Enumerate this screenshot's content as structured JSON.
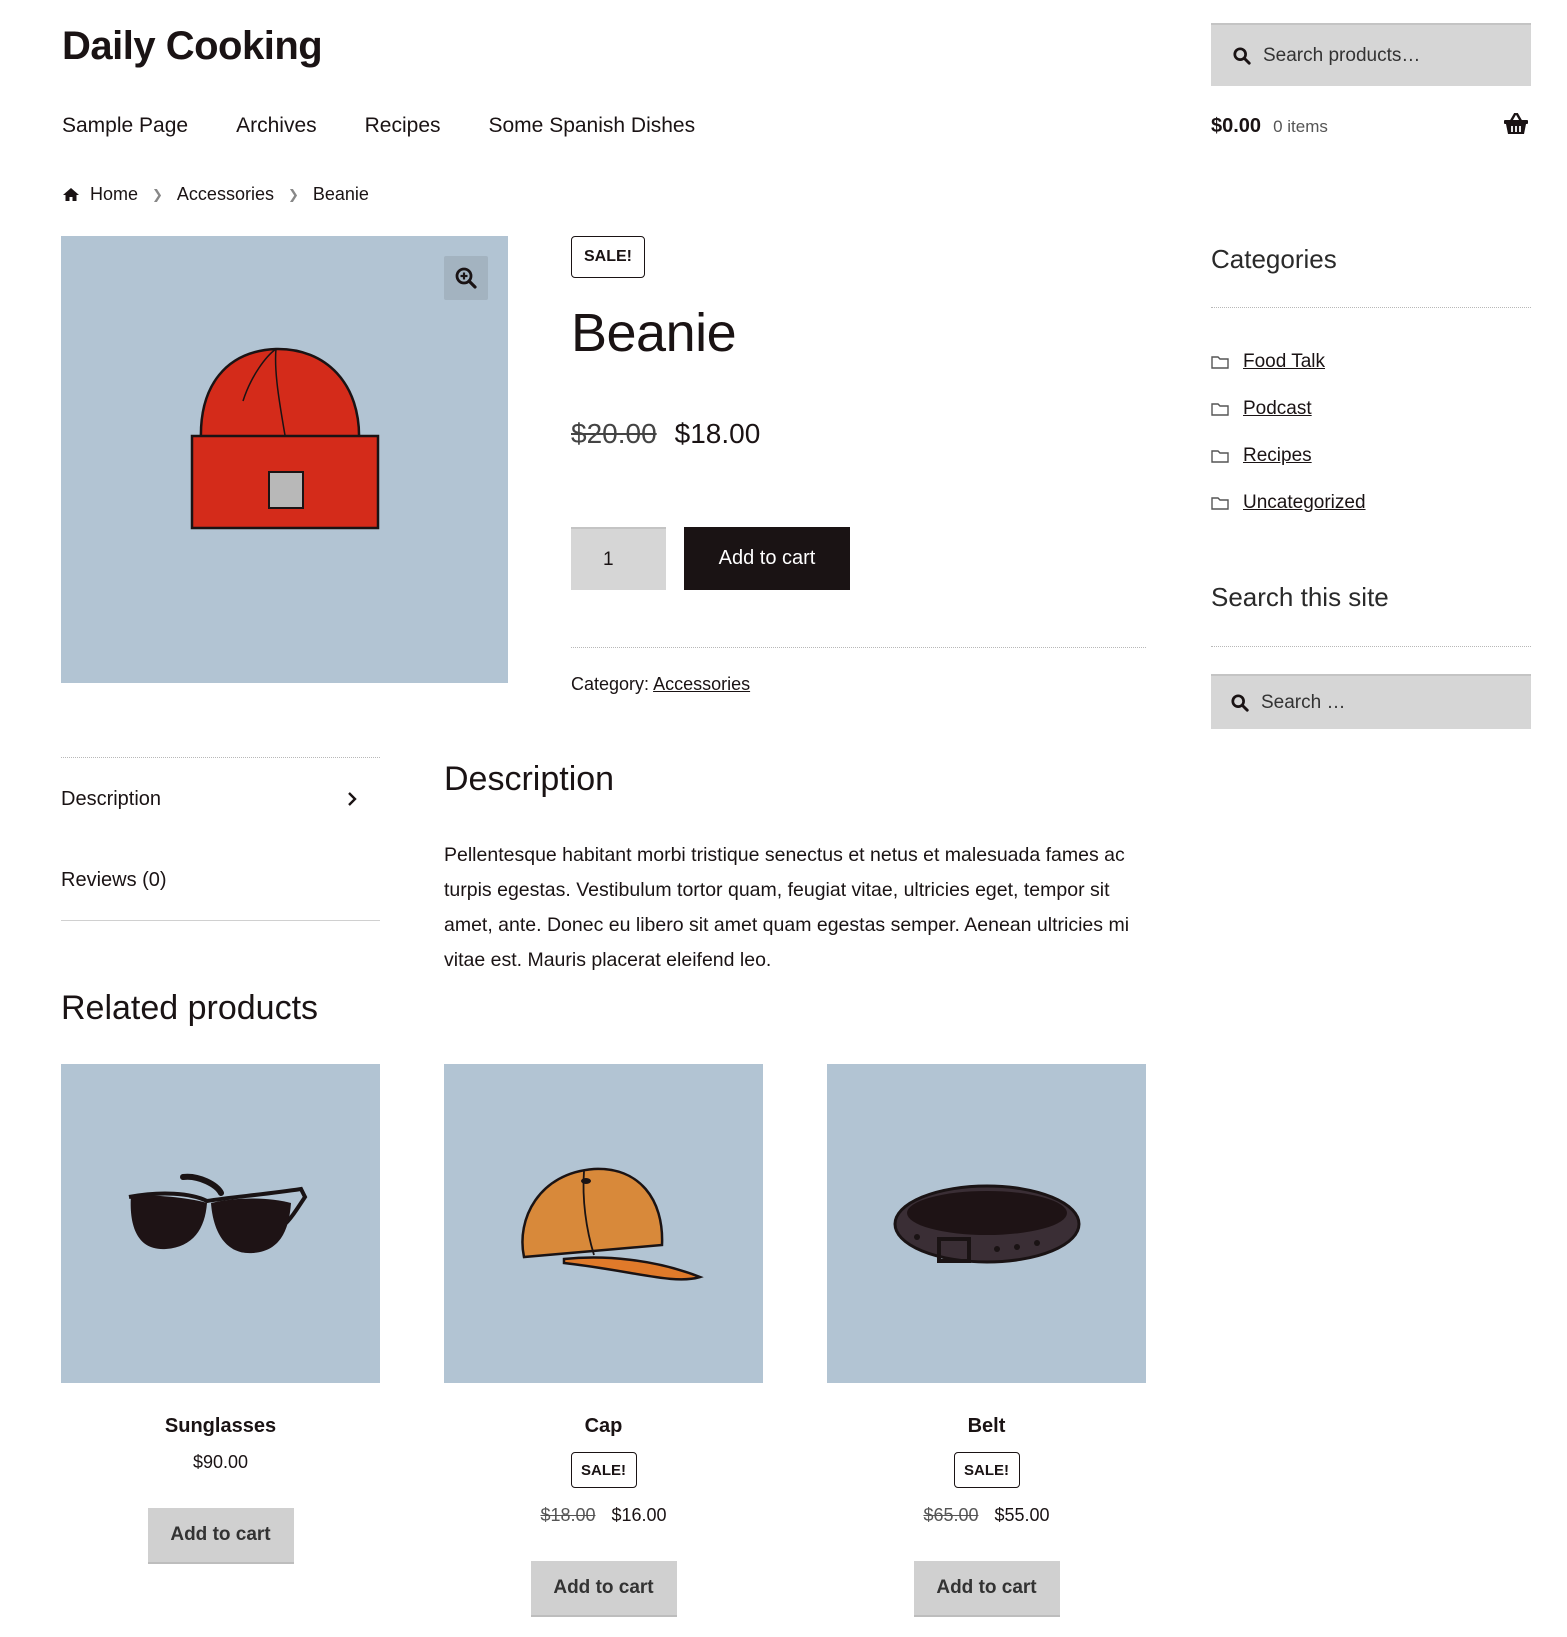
{
  "site": {
    "title": "Daily Cooking"
  },
  "nav": [
    "Sample Page",
    "Archives",
    "Recipes",
    "Some Spanish Dishes"
  ],
  "header_search": {
    "placeholder": "Search products…"
  },
  "cart": {
    "amount": "$0.00",
    "items": "0 items",
    "icon": "basket-icon"
  },
  "breadcrumb": [
    "Home",
    "Accessories",
    "Beanie"
  ],
  "product": {
    "sale_badge": "SALE!",
    "title": "Beanie",
    "old_price": "$20.00",
    "price": "$18.00",
    "quantity": "1",
    "add_to_cart": "Add to cart",
    "category_label": "Category:",
    "category": "Accessories",
    "image_bg": "#b2c4d3"
  },
  "sidebar": {
    "categories_title": "Categories",
    "categories": [
      "Food Talk",
      "Podcast",
      "Recipes",
      "Uncategorized"
    ],
    "search_title": "Search this site",
    "search_placeholder": "Search …"
  },
  "tabs": [
    "Description",
    "Reviews (0)"
  ],
  "description": {
    "title": "Description",
    "text": "Pellentesque habitant morbi tristique senectus et netus et malesuada fames ac turpis egestas. Vestibulum tortor quam, feugiat vitae, ultricies eget, tempor sit amet, ante. Donec eu libero sit amet quam egestas semper. Aenean ultricies mi vitae est. Mauris placerat eleifend leo."
  },
  "related": {
    "title": "Related products",
    "items": [
      {
        "name": "Sunglasses",
        "price": "$90.00",
        "old_price": "",
        "sale": "",
        "button": "Add to cart"
      },
      {
        "name": "Cap",
        "price": "$16.00",
        "old_price": "$18.00",
        "sale": "SALE!",
        "button": "Add to cart"
      },
      {
        "name": "Belt",
        "price": "$55.00",
        "old_price": "$65.00",
        "sale": "SALE!",
        "button": "Add to cart"
      }
    ]
  },
  "colors": {
    "text": "#1a1314",
    "button_dark": "#1a1314",
    "button_light": "#d0d0d0",
    "input_bg": "#d6d6d6",
    "beanie": "#d42b1a",
    "cap": "#d8893a"
  }
}
